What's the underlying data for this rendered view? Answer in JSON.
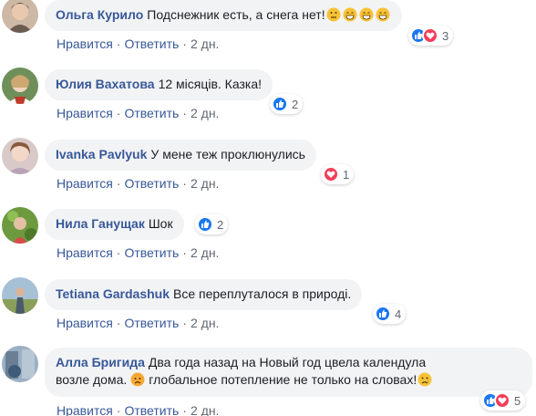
{
  "actions": {
    "like": "Нравится",
    "reply": "Ответить",
    "time": "2 дн."
  },
  "comments": [
    {
      "author": "Ольга Курило",
      "text": "Подснежник есть, а снега нет!",
      "emojis": [
        "thinking",
        "grin",
        "grin",
        "grin"
      ],
      "reactions": [
        "like",
        "love"
      ],
      "count": "3"
    },
    {
      "author": "Юлия Вахатова",
      "text": "12 місяців. Казка!",
      "reactions": [
        "like"
      ],
      "count": "2"
    },
    {
      "author": "Ivanka Pavlyuk",
      "text": "У мене теж проклюнулись",
      "reactions": [
        "love"
      ],
      "count": "1"
    },
    {
      "author": "Нила Ганущак",
      "text": "Шок",
      "reactions": [
        "like"
      ],
      "count": "2"
    },
    {
      "author": "Tetiana Gardashuk",
      "text": "Все переплуталося в природі.",
      "reactions": [
        "like"
      ],
      "count": "4"
    },
    {
      "author": "Алла Бригида",
      "text_line1": "Два года назад на Новый год цвела календула",
      "text_line2_a": "возле дома.",
      "text_line2_b": "глобальное потепление не только на словах!",
      "reactions": [
        "like",
        "love"
      ],
      "count": "5"
    }
  ]
}
